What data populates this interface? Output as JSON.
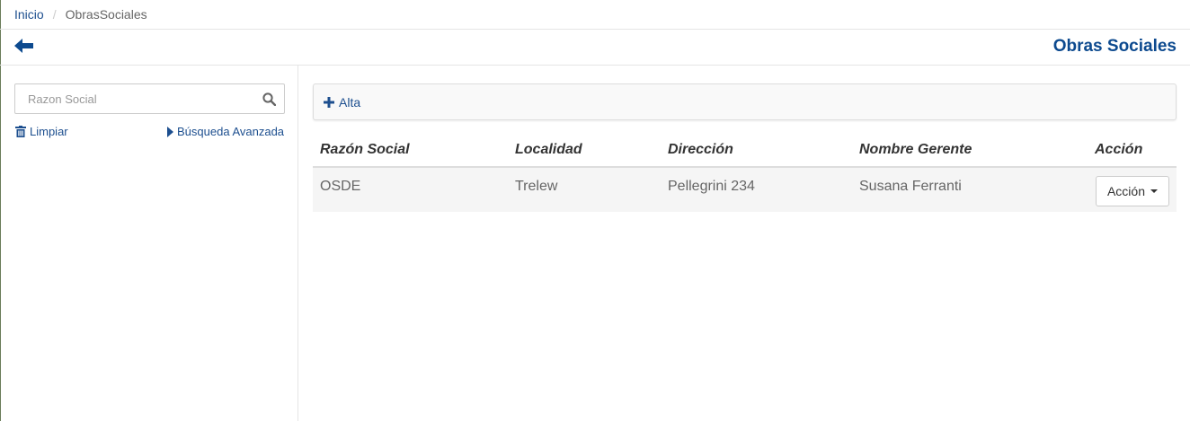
{
  "breadcrumb": {
    "home": "Inicio",
    "separator": "/",
    "current": "ObrasSociales"
  },
  "header": {
    "title": "Obras Sociales",
    "back_icon": "arrow-left-icon"
  },
  "sidebar": {
    "search_placeholder": "Razon Social",
    "search_value": "",
    "clear_label": "Limpiar",
    "advanced_label": "Búsqueda Avanzada"
  },
  "toolbar": {
    "add_label": "Alta"
  },
  "table": {
    "columns": [
      "Razón Social",
      "Localidad",
      "Dirección",
      "Nombre Gerente",
      "Acción"
    ],
    "rows": [
      {
        "razon_social": "OSDE",
        "localidad": "Trelew",
        "direccion": "Pellegrini 234",
        "gerente": "Susana Ferranti",
        "action_label": "Acción"
      }
    ]
  },
  "colors": {
    "accent": "#0d4a8f",
    "link": "#1d4f8f"
  }
}
